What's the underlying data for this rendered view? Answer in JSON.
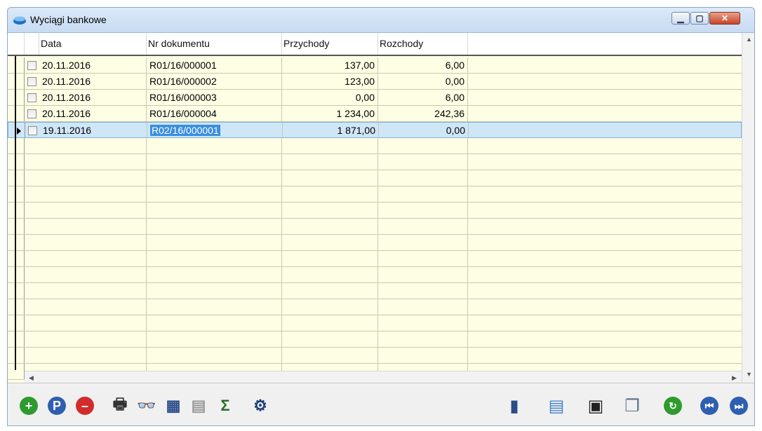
{
  "window": {
    "title": "Wyciągi bankowe",
    "controls": {
      "minimize": "▁",
      "maximize": "▢",
      "close": "✕"
    }
  },
  "grid": {
    "columns": [
      "Data",
      "Nr dokumentu",
      "Przychody",
      "Rozchody"
    ],
    "rows": [
      {
        "date": "20.11.2016",
        "doc": "R01/16/000001",
        "income": "137,00",
        "expense": "6,00"
      },
      {
        "date": "20.11.2016",
        "doc": "R01/16/000002",
        "income": "123,00",
        "expense": "0,00"
      },
      {
        "date": "20.11.2016",
        "doc": "R01/16/000003",
        "income": "0,00",
        "expense": "6,00"
      },
      {
        "date": "20.11.2016",
        "doc": "R01/16/000004",
        "income": "1 234,00",
        "expense": "242,36"
      },
      {
        "date": "19.11.2016",
        "doc": "R02/16/000001",
        "income": "1 871,00",
        "expense": "0,00"
      }
    ],
    "selected_row": 4,
    "scroll": {
      "up": "▲",
      "down": "▼",
      "left": "◀",
      "right": "▶"
    }
  },
  "toolbar": {
    "left": [
      {
        "name": "add-icon",
        "glyph": "+",
        "color": "#2e9b2e"
      },
      {
        "name": "view-icon",
        "glyph": "P",
        "color": "#2f5fb0"
      },
      {
        "name": "delete-icon",
        "glyph": "–",
        "color": "#d12b2b"
      },
      {
        "name": "print-icon",
        "glyph": "🖶",
        "color": "#333333"
      },
      {
        "name": "binoculars-icon",
        "glyph": "👓",
        "color": "#222222"
      },
      {
        "name": "table-icon",
        "glyph": "▦",
        "color": "#2b4c8a"
      },
      {
        "name": "filter-icon",
        "glyph": "▤",
        "color": "#9a9a9a"
      },
      {
        "name": "sum-icon",
        "glyph": "Σ",
        "color": "#2b6b2b"
      },
      {
        "name": "settings-icon",
        "glyph": "⚙",
        "color": "#1f3f7a"
      }
    ],
    "right": [
      {
        "name": "chart-icon",
        "glyph": "▮",
        "color": "#2b4c8a"
      },
      {
        "name": "document-icon",
        "glyph": "▤",
        "color": "#3f7fd0"
      },
      {
        "name": "save-icon",
        "glyph": "▣",
        "color": "#222222"
      },
      {
        "name": "windows-icon",
        "glyph": "❐",
        "color": "#5a6f8a"
      },
      {
        "name": "refresh-icon",
        "glyph": "↻",
        "color": "#2e9b2e"
      },
      {
        "name": "first-icon",
        "glyph": "⏮",
        "color": "#2f5fb0"
      },
      {
        "name": "last-icon",
        "glyph": "⏭",
        "color": "#2f5fb0"
      }
    ]
  }
}
